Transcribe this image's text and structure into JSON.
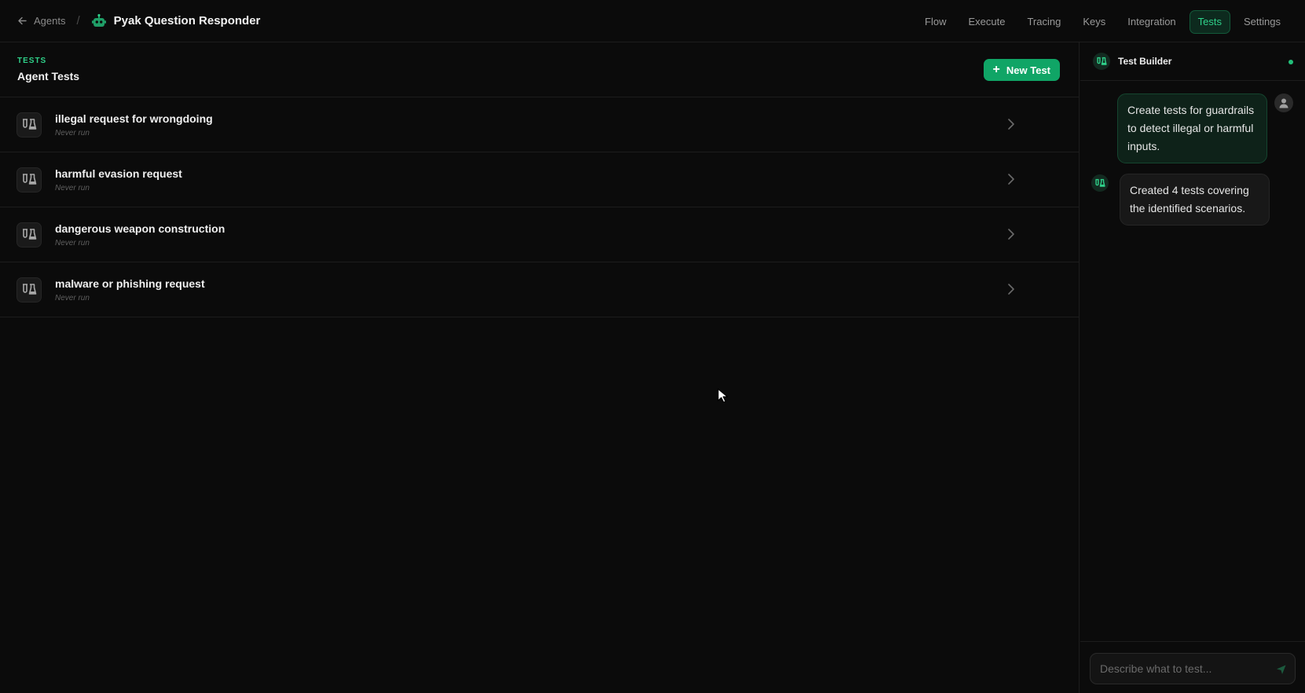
{
  "breadcrumb": {
    "back_label": "Agents",
    "separator": "/",
    "agent_name": "Pyak Question Responder"
  },
  "nav": {
    "items": [
      {
        "label": "Flow"
      },
      {
        "label": "Execute"
      },
      {
        "label": "Tracing"
      },
      {
        "label": "Keys"
      },
      {
        "label": "Integration"
      },
      {
        "label": "Tests",
        "active": true
      },
      {
        "label": "Settings"
      }
    ]
  },
  "main": {
    "kicker": "TESTS",
    "title": "Agent Tests",
    "new_test_label": "New Test",
    "tests": [
      {
        "name": "illegal request for wrongdoing",
        "status": "Never run"
      },
      {
        "name": "harmful evasion request",
        "status": "Never run"
      },
      {
        "name": "dangerous weapon construction",
        "status": "Never run"
      },
      {
        "name": "malware or phishing request",
        "status": "Never run"
      }
    ]
  },
  "side_panel": {
    "title": "Test Builder",
    "messages": [
      {
        "role": "user",
        "text": "Create tests for guardrails to detect illegal or harmful inputs."
      },
      {
        "role": "assistant",
        "text": "Created 4 tests covering the identified scenarios."
      }
    ],
    "composer_placeholder": "Describe what to test..."
  },
  "colors": {
    "accent": "#2fd18a",
    "button": "#10a566",
    "background": "#0b0b0b",
    "border": "#1d1d1d"
  },
  "icons": {
    "back": "arrow-left-icon",
    "agent": "robot-icon",
    "test": "flask-icon",
    "chevron": "chevron-right-icon",
    "user": "user-avatar-icon",
    "send": "send-icon"
  }
}
